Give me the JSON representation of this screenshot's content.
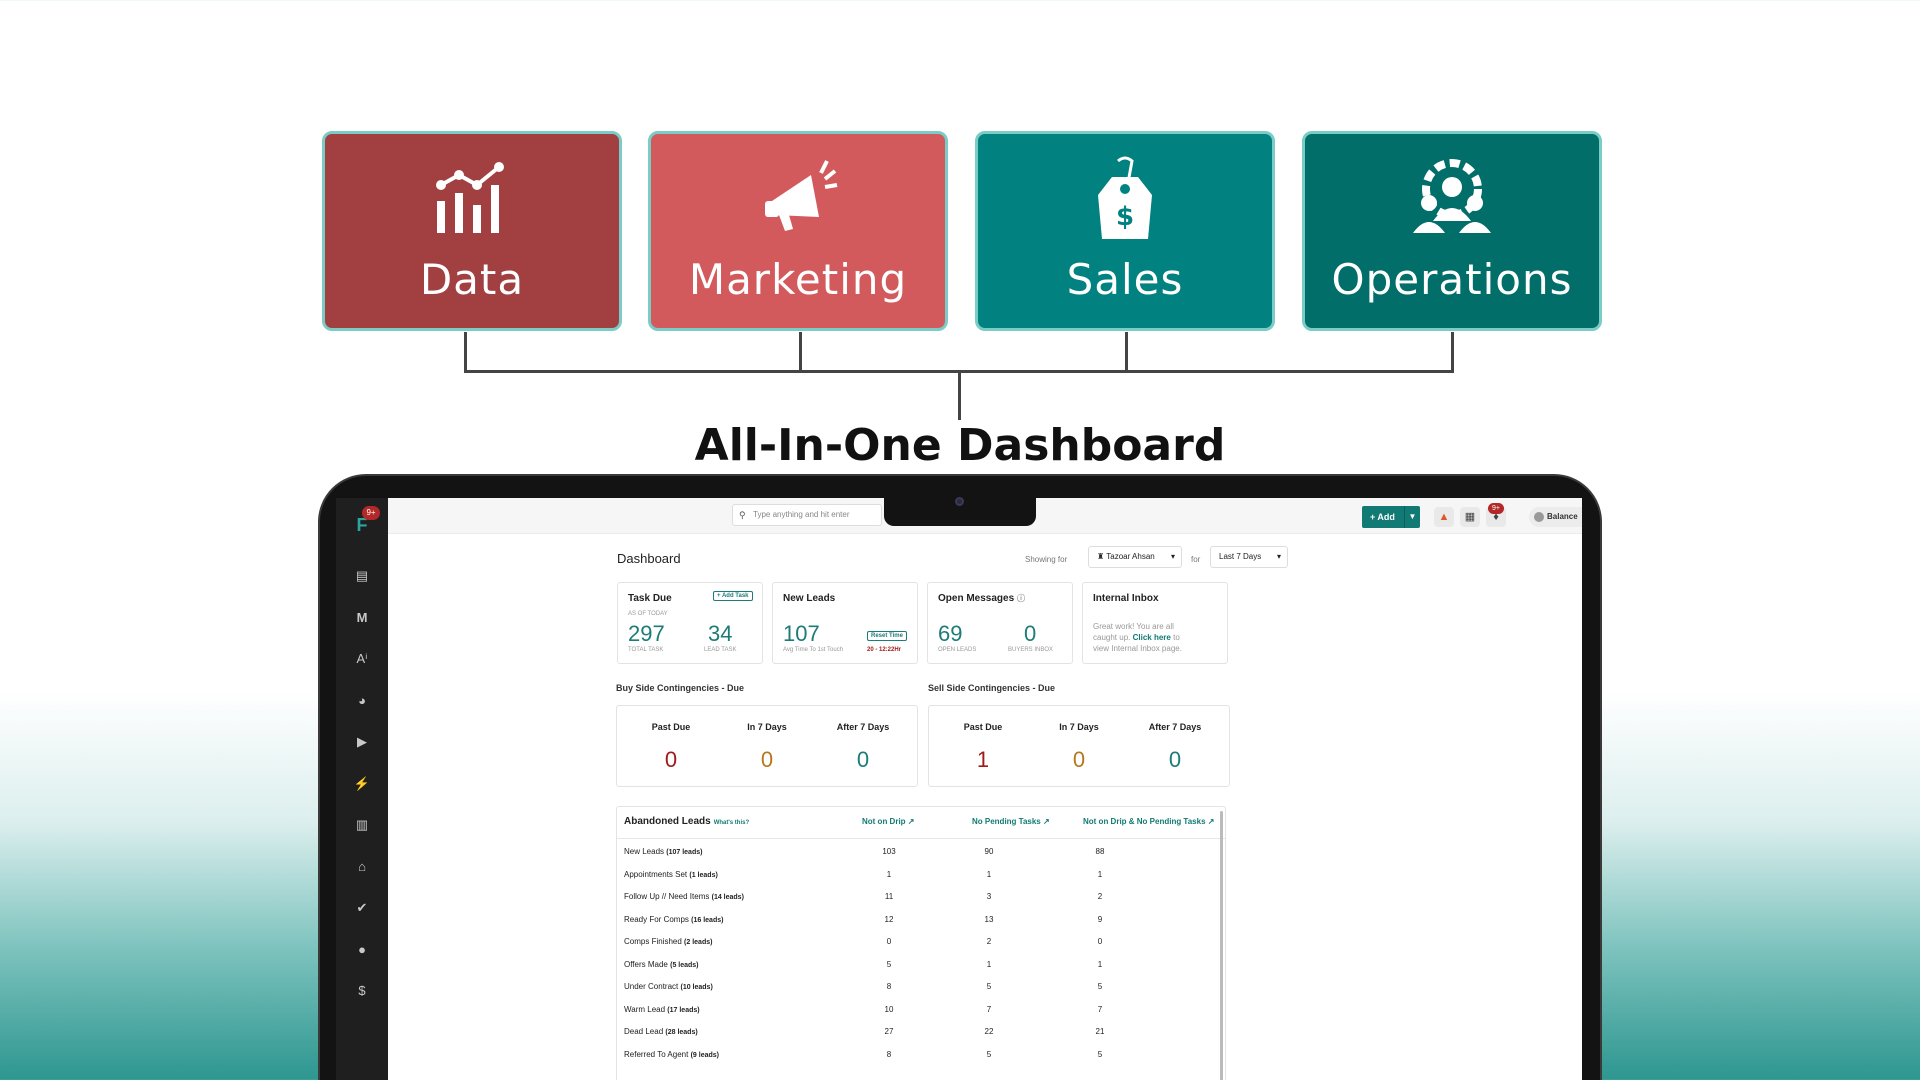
{
  "categories": [
    {
      "label": "Data",
      "icon": "chart-icon",
      "color": "#a23f41"
    },
    {
      "label": "Marketing",
      "icon": "megaphone-icon",
      "color": "#d35a5c"
    },
    {
      "label": "Sales",
      "icon": "price-tag-icon",
      "color": "#018280"
    },
    {
      "label": "Operations",
      "icon": "team-gear-icon",
      "color": "#016e6a"
    }
  ],
  "headline": "All-In-One Dashboard",
  "app": {
    "sidebar_badge": "9+",
    "search_placeholder": "Type anything and hit enter",
    "add_label": "+ Add",
    "notification_badge": "9+",
    "balance_label": "Balance",
    "page_title": "Dashboard",
    "showing_for_label": "Showing for",
    "user_filter": "Tazoar Ahsan",
    "for_label": "for",
    "period_filter": "Last 7 Days"
  },
  "kpis": {
    "task_due": {
      "title": "Task Due",
      "add_task": "+ Add Task",
      "as_of": "AS OF TODAY",
      "total": "297",
      "total_label": "TOTAL TASK",
      "lead": "34",
      "lead_label": "LEAD TASK"
    },
    "new_leads": {
      "title": "New Leads",
      "value": "107",
      "sub": "Avg Time To 1st Touch",
      "reset": "Reset Time",
      "time": "20 - 12:22Hr"
    },
    "open_messages": {
      "title": "Open Messages",
      "open": "69",
      "open_label": "OPEN LEADS",
      "buyers": "0",
      "buyers_label": "BUYERS INBOX"
    },
    "internal_inbox": {
      "title": "Internal Inbox",
      "text_a": "Great work! You are all caught up.",
      "link": "Click here",
      "text_b": "to view Internal Inbox page."
    }
  },
  "contingencies": {
    "buy": {
      "title": "Buy Side Contingencies - Due",
      "past_due_label": "Past Due",
      "in7_label": "In 7 Days",
      "after7_label": "After 7 Days",
      "past_due": "0",
      "in7": "0",
      "after7": "0"
    },
    "sell": {
      "title": "Sell Side Contingencies - Due",
      "past_due_label": "Past Due",
      "in7_label": "In 7 Days",
      "after7_label": "After 7 Days",
      "past_due": "1",
      "in7": "0",
      "after7": "0"
    }
  },
  "abandoned": {
    "title": "Abandoned Leads",
    "whats_this": "What's this?",
    "columns": [
      "Not on Drip",
      "No Pending Tasks",
      "Not on Drip & No Pending Tasks"
    ],
    "rows": [
      {
        "label": "New Leads",
        "count": "(107 leads)",
        "values": [
          "103",
          "90",
          "88"
        ]
      },
      {
        "label": "Appointments Set",
        "count": "(1 leads)",
        "values": [
          "1",
          "1",
          "1"
        ]
      },
      {
        "label": "Follow Up // Need Items",
        "count": "(14 leads)",
        "values": [
          "11",
          "3",
          "2"
        ]
      },
      {
        "label": "Ready For Comps",
        "count": "(16 leads)",
        "values": [
          "12",
          "13",
          "9"
        ]
      },
      {
        "label": "Comps Finished",
        "count": "(2 leads)",
        "values": [
          "0",
          "2",
          "0"
        ]
      },
      {
        "label": "Offers Made",
        "count": "(5 leads)",
        "values": [
          "5",
          "1",
          "1"
        ]
      },
      {
        "label": "Under Contract",
        "count": "(10 leads)",
        "values": [
          "8",
          "5",
          "5"
        ]
      },
      {
        "label": "Warm Lead",
        "count": "(17 leads)",
        "values": [
          "10",
          "7",
          "7"
        ]
      },
      {
        "label": "Dead Lead",
        "count": "(28 leads)",
        "values": [
          "27",
          "22",
          "21"
        ]
      },
      {
        "label": "Referred To Agent",
        "count": "(9 leads)",
        "values": [
          "8",
          "5",
          "5"
        ]
      }
    ]
  },
  "colors": {
    "teal": "#117a74",
    "due_red": "#a11a1a",
    "due_amber": "#b5781d",
    "ok_teal": "#1c7c78"
  }
}
